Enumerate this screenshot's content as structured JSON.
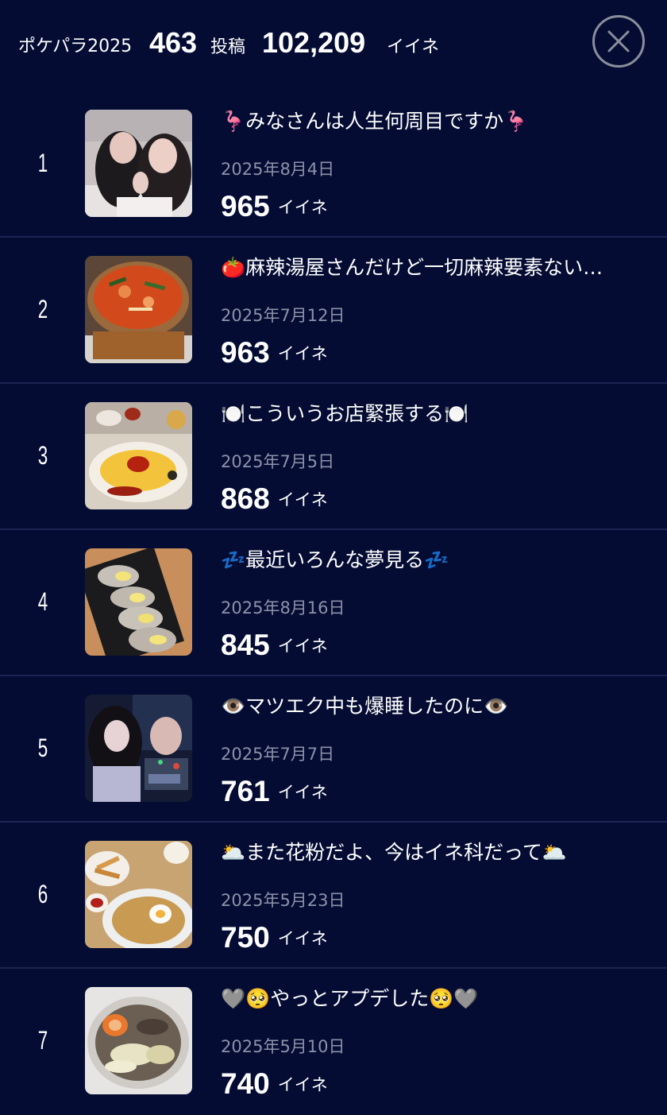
{
  "header": {
    "app_label": "ポケパラ2025",
    "posts_count": "463",
    "posts_unit": "投稿",
    "likes_count": "102,209",
    "likes_unit": "イイネ",
    "close_icon": "close-icon"
  },
  "colors": {
    "background": "#040c33",
    "divider": "#1c2452",
    "date_text": "#8d92a8",
    "close_ring": "#8a8e9c"
  },
  "posts": [
    {
      "rank": "1",
      "title": "🦩みなさんは人生何周目ですか🦩",
      "date": "2025年8月4日",
      "likes": "965",
      "likes_unit": "イイネ",
      "thumbnail": "two-people-selfie-photo"
    },
    {
      "rank": "2",
      "title": "🍅麻辣湯屋さんだけど一切麻辣要素ない…",
      "date": "2025年7月12日",
      "likes": "963",
      "likes_unit": "イイネ",
      "thumbnail": "tomato-soup-bowl-photo"
    },
    {
      "rank": "3",
      "title": "🍽️こういうお店緊張する🍽️",
      "date": "2025年7月5日",
      "likes": "868",
      "likes_unit": "イイネ",
      "thumbnail": "omurice-plate-photo"
    },
    {
      "rank": "4",
      "title": "💤最近いろんな夢見る💤",
      "date": "2025年8月16日",
      "likes": "845",
      "likes_unit": "イイネ",
      "thumbnail": "oysters-platter-photo"
    },
    {
      "rank": "5",
      "title": "👁️マツエク中も爆睡したのに👁️",
      "date": "2025年7月7日",
      "likes": "761",
      "likes_unit": "イイネ",
      "thumbnail": "two-people-night-photo"
    },
    {
      "rank": "6",
      "title": "🌥️また花粉だよ、今はイネ科だって🌥️",
      "date": "2025年5月23日",
      "likes": "750",
      "likes_unit": "イイネ",
      "thumbnail": "ramen-meal-photo"
    },
    {
      "rank": "7",
      "title": "🩶🥺やっとアプデした🥺🩶",
      "date": "2025年5月10日",
      "likes": "740",
      "likes_unit": "イイネ",
      "thumbnail": "hotpot-bowl-photo"
    }
  ]
}
